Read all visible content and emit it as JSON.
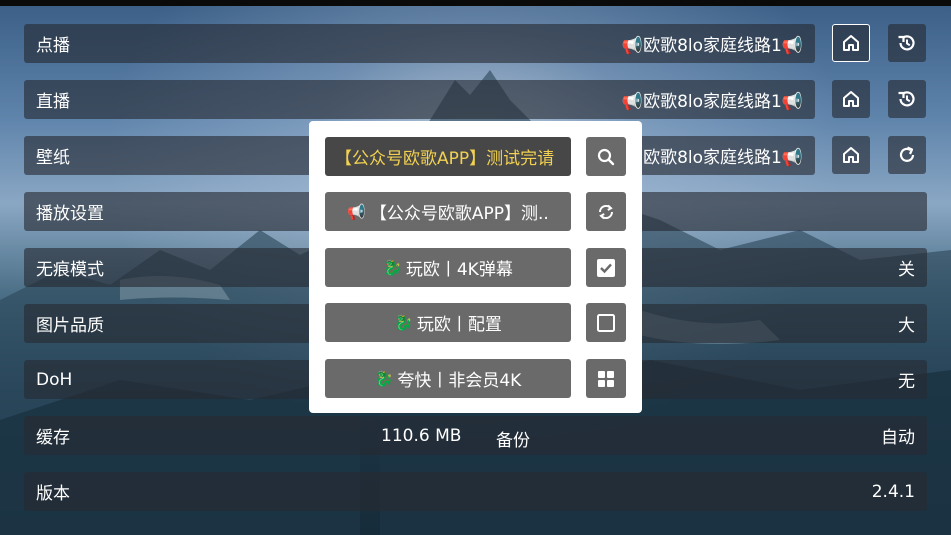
{
  "settings": {
    "rows": [
      {
        "label": "点播",
        "value": "📢欧歌8lo家庭线路1📢"
      },
      {
        "label": "直播",
        "value": "📢欧歌8lo家庭线路1📢"
      },
      {
        "label": "壁纸",
        "value": "📢欧歌8lo家庭线路1📢"
      },
      {
        "label": "播放设置",
        "value": ""
      },
      {
        "label": "无痕模式",
        "value": "关"
      },
      {
        "label": "图片品质",
        "value": "大"
      },
      {
        "label": "DoH",
        "value": "无"
      },
      {
        "label": "缓存",
        "value": "自动",
        "size": "110.6 MB",
        "backup": "备份"
      },
      {
        "label": "版本",
        "value": "2.4.1"
      }
    ],
    "icons": {
      "home": "home-icon",
      "history": "history-icon",
      "refresh": "refresh-icon"
    }
  },
  "dialog": {
    "options": [
      {
        "label": "【公众号欧歌APP】测试完请",
        "icon": "search-icon",
        "selected": true
      },
      {
        "prefix": "📢",
        "label": "【公众号欧歌APP】测..",
        "icon": "refresh-icon"
      },
      {
        "prefix": "🐉",
        "label": "玩欧丨4K弹幕",
        "icon": "checkbox-checked-icon"
      },
      {
        "prefix": "🐉",
        "label": "玩欧丨配置",
        "icon": "checkbox-empty-icon"
      },
      {
        "prefix": "🐉",
        "label": "夸快丨非会员4K",
        "icon": "grid-icon"
      }
    ]
  },
  "colors": {
    "selected_text": "#f2d152",
    "row_bg": "#262a32",
    "option_bg": "#6a6a6a"
  }
}
